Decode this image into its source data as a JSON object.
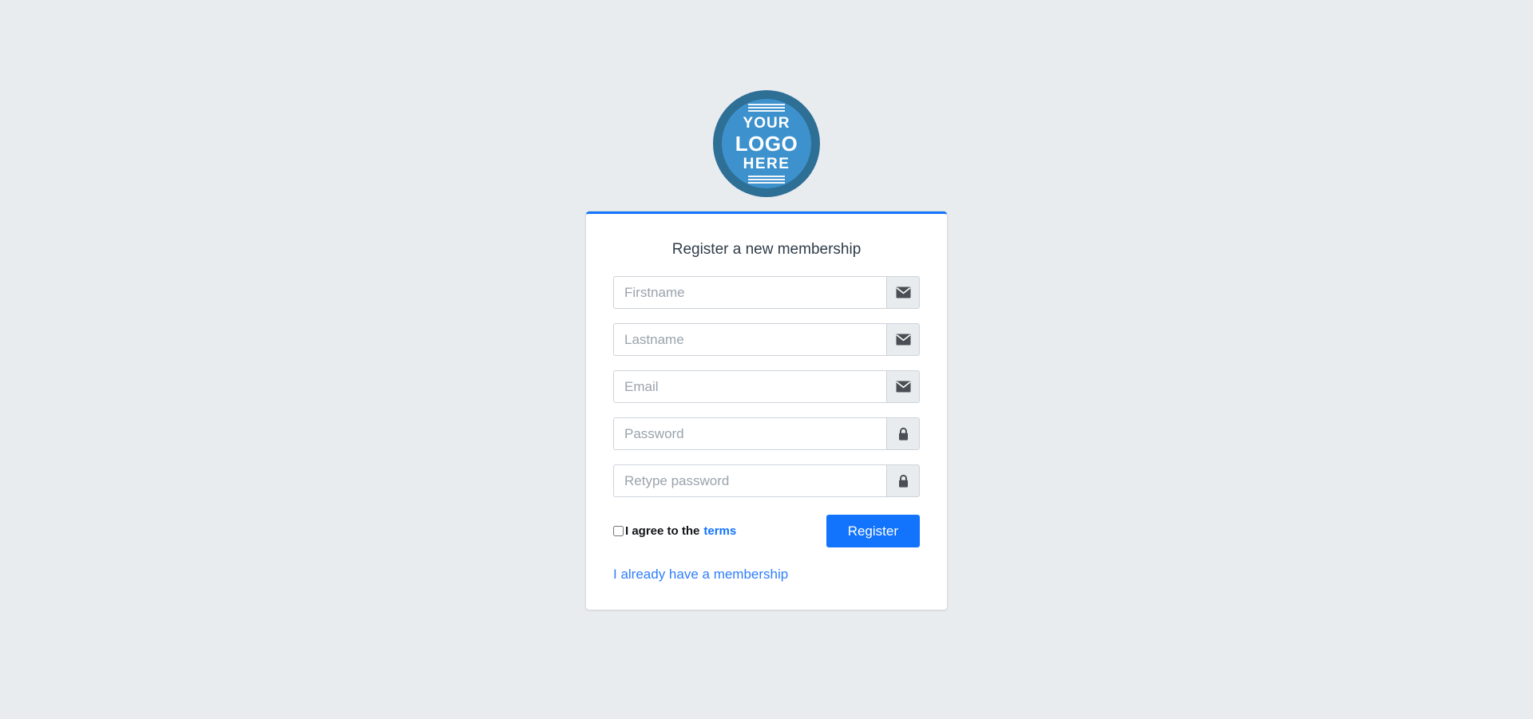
{
  "background_color": "#e9ecef",
  "accent_color": "#1273fd",
  "logo": {
    "name": "your-logo-here-badge",
    "line1": "YOUR",
    "line2": "LOGO",
    "line3": "HERE",
    "ring_color": "#2e6f96",
    "inner_color": "#3d92ce"
  },
  "card": {
    "title": "Register a new membership",
    "top_border_color": "#1273fd"
  },
  "fields": [
    {
      "name": "firstname",
      "placeholder": "Firstname",
      "value": "",
      "type": "text",
      "icon": "envelope-icon"
    },
    {
      "name": "lastname",
      "placeholder": "Lastname",
      "value": "",
      "type": "text",
      "icon": "envelope-icon"
    },
    {
      "name": "email",
      "placeholder": "Email",
      "value": "",
      "type": "email",
      "icon": "envelope-icon"
    },
    {
      "name": "password",
      "placeholder": "Password",
      "value": "",
      "type": "password",
      "icon": "lock-icon"
    },
    {
      "name": "retype-password",
      "placeholder": "Retype password",
      "value": "",
      "type": "password",
      "icon": "lock-icon"
    }
  ],
  "agree": {
    "checked": false,
    "label": "I agree to the",
    "terms_label": "terms"
  },
  "register_button": {
    "label": "Register"
  },
  "membership_link": {
    "label": "I already have a membership"
  }
}
